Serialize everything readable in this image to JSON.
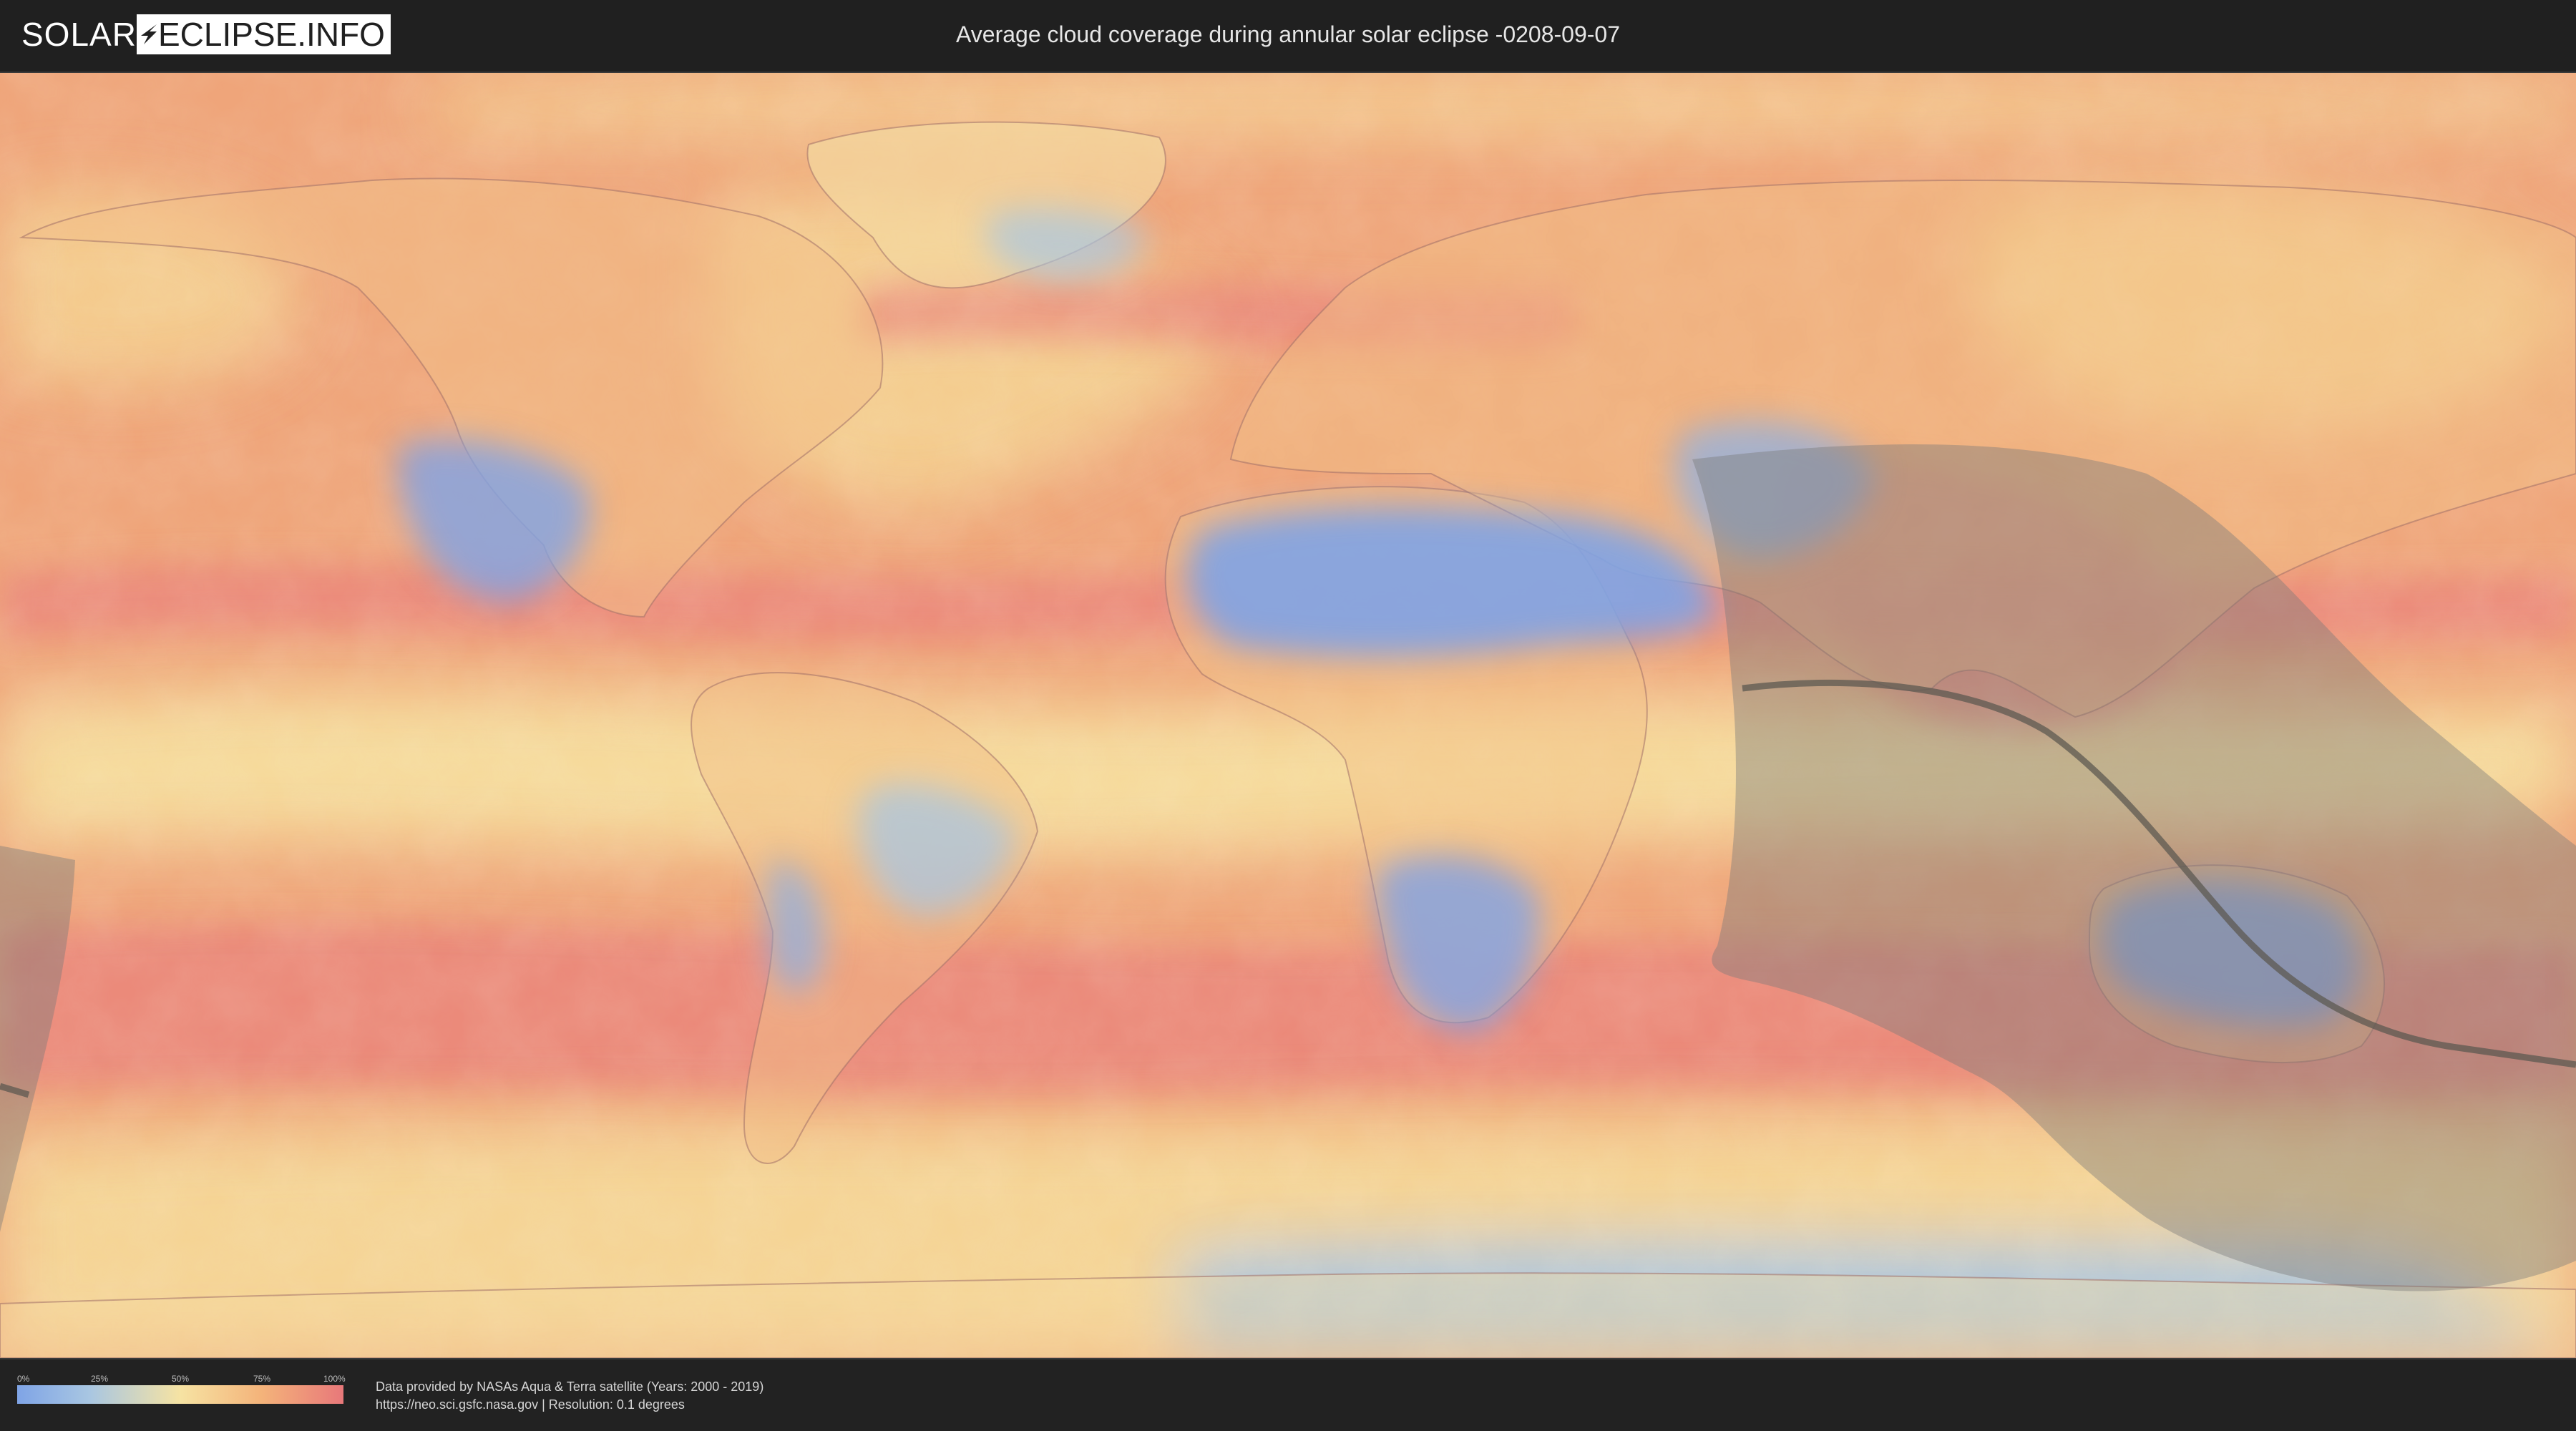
{
  "header": {
    "logo_left": "SOLAR",
    "logo_right": "ECLIPSE.INFO",
    "title": "Average cloud coverage during annular solar eclipse -0208-09-07"
  },
  "map": {
    "colors": {
      "clear": "#7fa4e6",
      "low": "#a8c6e2",
      "mid": "#f6e3a3",
      "high": "#f4b37a",
      "overcast": "#e8787a",
      "eclipse_shade": "#7a7a7a",
      "center_line": "#5e5a52"
    }
  },
  "legend": {
    "ticks": [
      "0%",
      "25%",
      "50%",
      "75%",
      "100%"
    ]
  },
  "credits": {
    "line1": "Data provided by NASAs Aqua & Terra satellite (Years: 2000 - 2019)",
    "line2": "https://neo.sci.gsfc.nasa.gov | Resolution: 0.1 degrees"
  }
}
